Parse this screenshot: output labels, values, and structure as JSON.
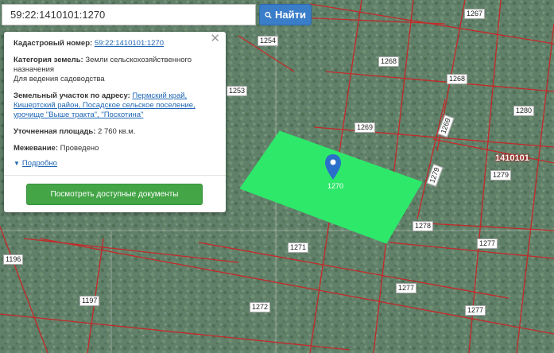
{
  "search": {
    "value": "59:22:1410101:1270",
    "button_label": "Найти"
  },
  "card": {
    "cadastral_label": "Кадастровый номер:",
    "cadastral_value": "59:22:1410101:1270",
    "category_label": "Категория земель:",
    "category_value": "Земли сельскохозяйственного назначения",
    "usage_value": "Для ведения садоводства",
    "address_label": "Земельный участок по адресу:",
    "address_value": "Пермский край, Кишертский район, Посадское сельское поселение, урочище \"Выше тракта\", \"Поскотина\"",
    "area_label": "Уточненная площадь:",
    "area_value": "2 760 кв.м.",
    "survey_label": "Межевание:",
    "survey_value": "Проведено",
    "more_label": "Подробно",
    "docs_button": "Посмотреть доступные документы"
  },
  "map": {
    "selected_parcel_label": "1270",
    "quarter_label": "1410101",
    "parcels": [
      "1267",
      "1254",
      "1268",
      "1253",
      "1268",
      "1280",
      "1269",
      "1269",
      "1279",
      "1279",
      "1278",
      "1271",
      "1277",
      "1196",
      "1197",
      "1272",
      "1277"
    ],
    "colors": {
      "parcel_fill": "#2ee86a",
      "boundary": "#c62828",
      "marker": "#2a6fc9"
    }
  }
}
